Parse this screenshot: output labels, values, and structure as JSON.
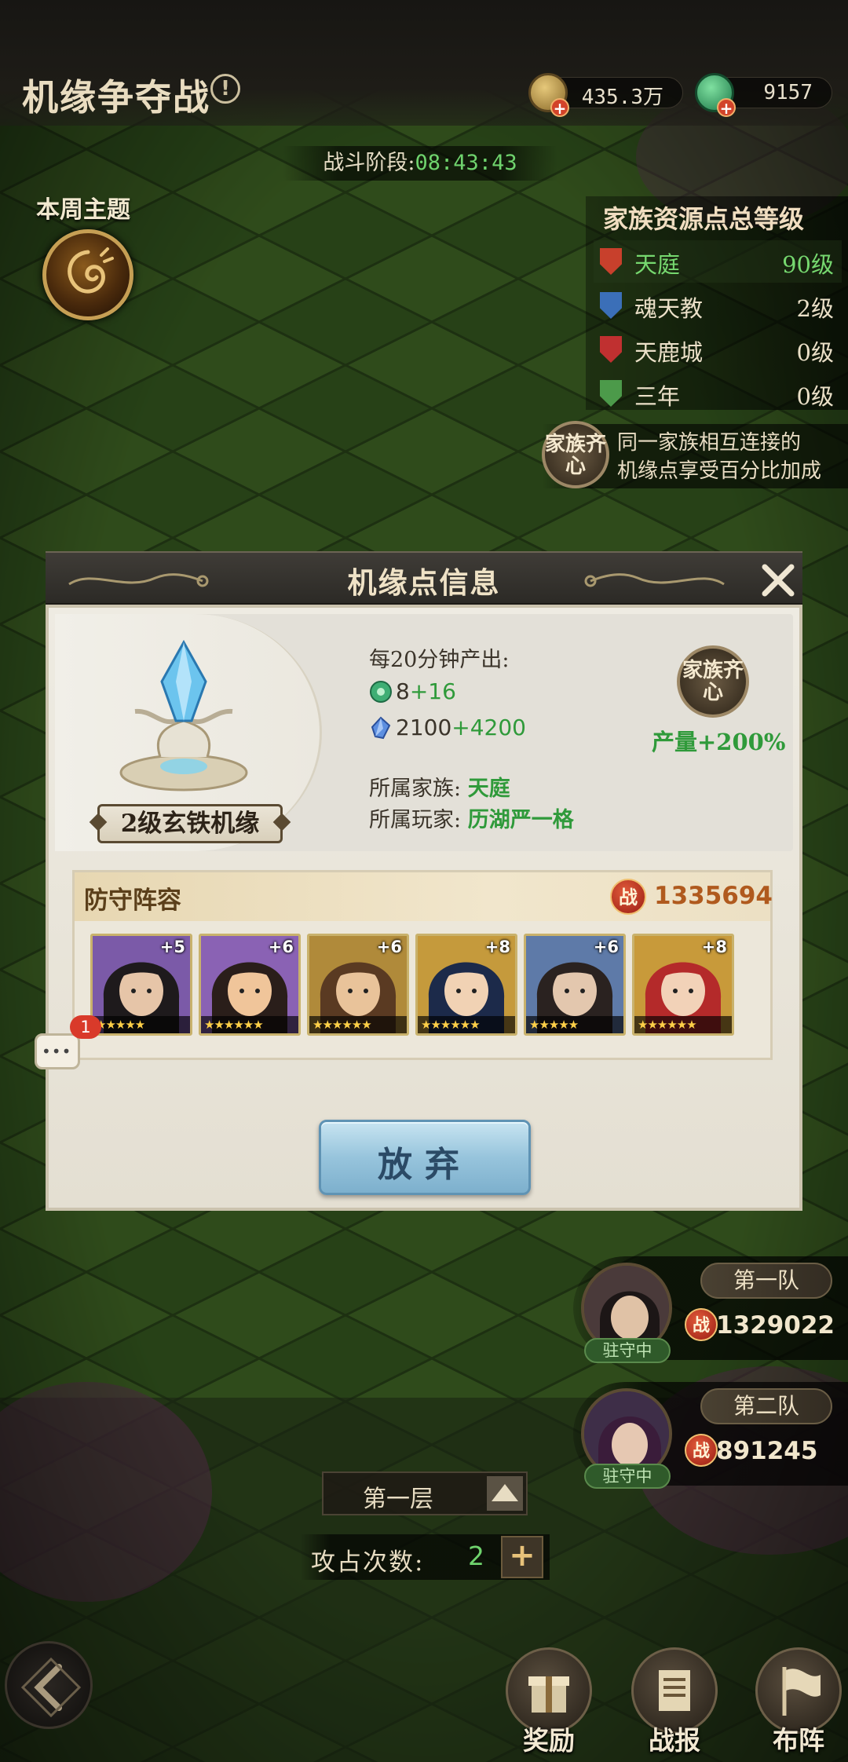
{
  "header": {
    "title": "机缘争夺战",
    "info_icon": "!",
    "coins": "435.3万",
    "jade": "9157"
  },
  "battle_phase": {
    "label": "战斗阶段:",
    "time": "08:43:43"
  },
  "weekly_theme": {
    "label": "本周主题"
  },
  "family_levels": {
    "title": "家族资源点总等级",
    "rows": [
      {
        "name": "天庭",
        "level": "90级",
        "color": "#c8402c"
      },
      {
        "name": "魂天教",
        "level": "2级",
        "color": "#3b6fb8"
      },
      {
        "name": "天鹿城",
        "level": "0级",
        "color": "#c03030"
      },
      {
        "name": "三年",
        "level": "0级",
        "color": "#4c9a4a"
      }
    ],
    "unite_badge": "家族齐心",
    "unite_tip_line1": "同一家族相互连接的",
    "unite_tip_line2": "机缘点享受百分比加成"
  },
  "modal": {
    "title": "机缘点信息",
    "node_name": "2级玄铁机缘",
    "output_label": "每20分钟产出:",
    "output_jade": "8",
    "output_jade_bonus": "+16",
    "output_iron": "2100",
    "output_iron_bonus": "+4200",
    "family_label": "所属家族:",
    "family_value": "天庭",
    "player_label": "所属玩家:",
    "player_value": "历湖严一格",
    "unite_badge": "家族齐心",
    "yield": "产量+200%",
    "defense": {
      "title": "防守阵容",
      "power_icon": "战",
      "power": "1335694",
      "heroes": [
        {
          "level": "+5",
          "stars": "★★★★★",
          "bg": "#7b5aa8",
          "hair": "#1e1a1c",
          "skin": "#e6c5a8"
        },
        {
          "level": "+6",
          "stars": "★★★★★★",
          "bg": "#8a62b4",
          "hair": "#2a1e1a",
          "skin": "#f0c59a"
        },
        {
          "level": "+6",
          "stars": "★★★★★★",
          "bg": "#b08a3a",
          "hair": "#5a3a22",
          "skin": "#e9c39a"
        },
        {
          "level": "+8",
          "stars": "★★★★★★",
          "bg": "#c59a3c",
          "hair": "#1c2a4a",
          "skin": "#f1d2b4"
        },
        {
          "level": "+6",
          "stars": "★★★★★",
          "bg": "#5e7aa8",
          "hair": "#2a2220",
          "skin": "#e3c7ae"
        },
        {
          "level": "+8",
          "stars": "★★★★★★",
          "bg": "#c89a3a",
          "hair": "#b42a2a",
          "skin": "#f2d2b8"
        }
      ]
    },
    "abandon_button": "放弃"
  },
  "chat": {
    "dots": "•••",
    "unread": "1"
  },
  "teams": [
    {
      "name": "第一队",
      "status": "驻守中",
      "power_icon": "战",
      "power": "1329022"
    },
    {
      "name": "第二队",
      "status": "驻守中",
      "power_icon": "战",
      "power": "891245"
    }
  ],
  "floor": {
    "label": "第一层"
  },
  "attack": {
    "label": "攻占次数:",
    "count": "2",
    "plus": "+"
  },
  "bottom_nav": [
    {
      "label": "奖励",
      "icon": "gift-icon"
    },
    {
      "label": "战报",
      "icon": "scroll-icon"
    },
    {
      "label": "布阵",
      "icon": "flag-icon"
    }
  ]
}
